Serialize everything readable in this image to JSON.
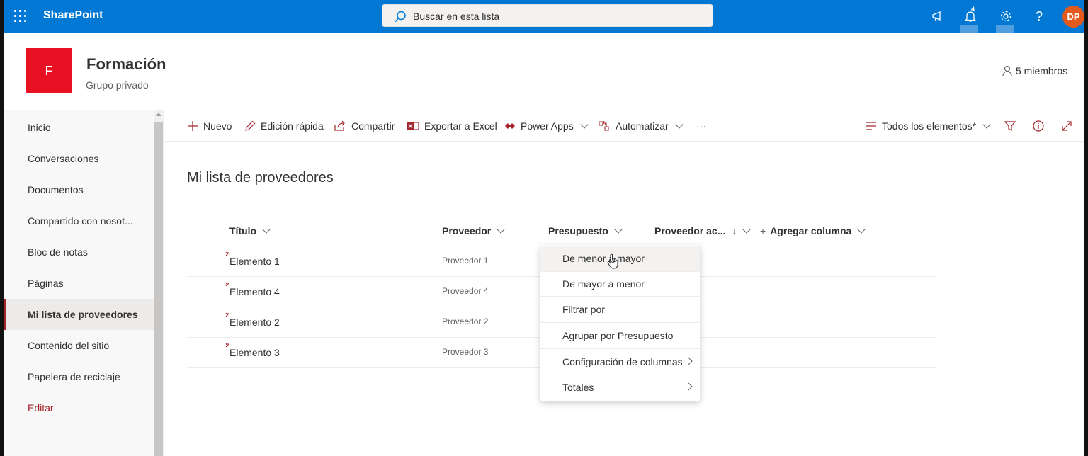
{
  "suitebar": {
    "app_name": "SharePoint",
    "search_placeholder": "Buscar en esta lista",
    "notifications_count": "4",
    "help_label": "?",
    "avatar_initials": "DP"
  },
  "site": {
    "logo_letter": "F",
    "title": "Formación",
    "subtitle": "Grupo privado",
    "members": "5 miembros"
  },
  "nav": {
    "items": [
      {
        "label": "Inicio"
      },
      {
        "label": "Conversaciones"
      },
      {
        "label": "Documentos"
      },
      {
        "label": "Compartido con nosot..."
      },
      {
        "label": "Bloc de notas"
      },
      {
        "label": "Páginas"
      },
      {
        "label": "Mi lista de proveedores",
        "selected": true
      },
      {
        "label": "Contenido del sitio"
      },
      {
        "label": "Papelera de reciclaje"
      },
      {
        "label": "Editar"
      }
    ]
  },
  "commandbar": {
    "new": "Nuevo",
    "quick_edit": "Edición rápida",
    "share": "Compartir",
    "export": "Exportar a Excel",
    "power_apps": "Power Apps",
    "automate": "Automatizar",
    "more": "···",
    "view": "Todos los elementos*"
  },
  "list": {
    "title": "Mi lista de proveedores",
    "columns": {
      "title": "Título",
      "provider": "Proveedor",
      "budget": "Presupuesto",
      "provider_act": "Proveedor ac...",
      "sort_arrow": "↓",
      "add_column": "Agregar columna",
      "add_plus": "+"
    },
    "rows": [
      {
        "title": "Elemento 1",
        "provider": "Proveedor 1"
      },
      {
        "title": "Elemento 4",
        "provider": "Proveedor 4"
      },
      {
        "title": "Elemento 2",
        "provider": "Proveedor 2"
      },
      {
        "title": "Elemento 3",
        "provider": "Proveedor 3"
      }
    ]
  },
  "column_menu": {
    "asc": "De menor a mayor",
    "desc": "De mayor a menor",
    "filter": "Filtrar por",
    "group": "Agrupar por Presupuesto",
    "settings": "Configuración de columnas",
    "totals": "Totales"
  },
  "colors": {
    "suitebar": "#0078d4",
    "site_logo": "#e81123",
    "accent": "#a4262c",
    "avatar": "#e35a1f"
  }
}
